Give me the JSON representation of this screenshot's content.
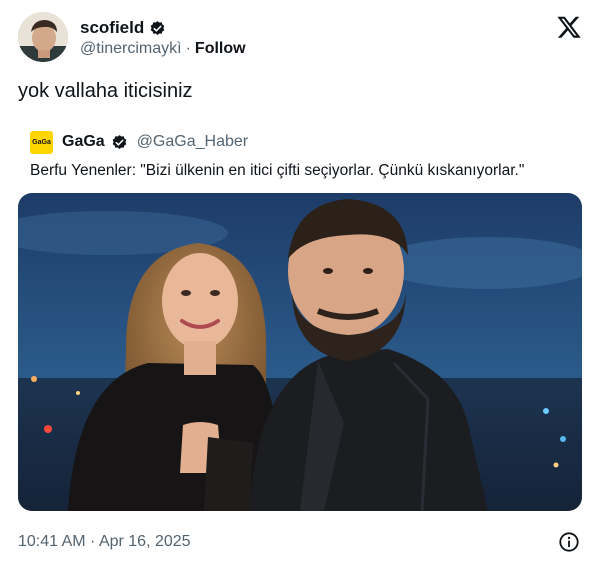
{
  "tweet": {
    "author": {
      "display_name": "scofield",
      "handle": "@tinercimaykì",
      "verified": true,
      "follow_label": "Follow",
      "separator": "·"
    },
    "text": "yok vallaha iticisiniz",
    "quote": {
      "avatar_text": "GaGa",
      "display_name": "GaGa",
      "handle": "@GaGa_Haber",
      "verified": true,
      "text": "Berfu Yenenler: \"Bizi ülkenin en itici çifti seçiyorlar. Çünkü kıskanıyorlar.\"",
      "media": "photo"
    },
    "timestamp": "10:41 AM · Apr 16, 2025"
  },
  "icons": {
    "brand": "x-logo-icon",
    "verified": "verified-badge-icon",
    "info": "info-icon"
  },
  "colors": {
    "text_primary": "#0f1419",
    "text_secondary": "#536471",
    "gaga_yellow": "#ffd500"
  }
}
